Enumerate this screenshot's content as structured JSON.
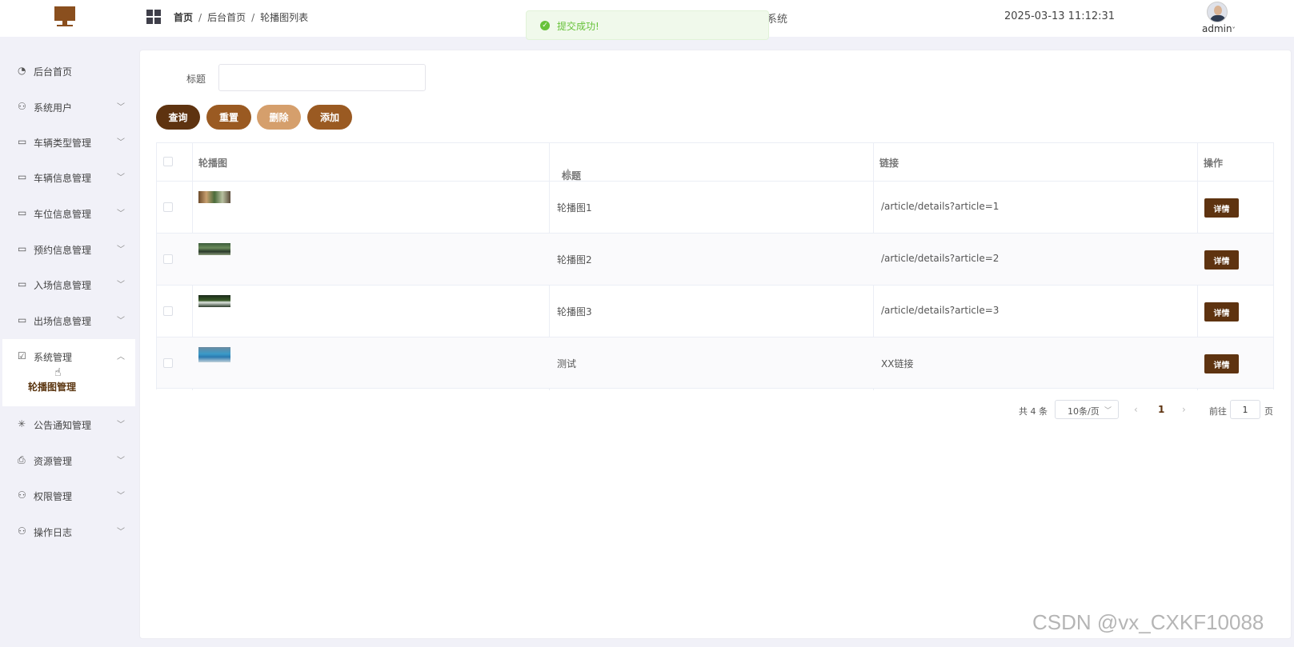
{
  "header": {
    "breadcrumb": [
      "首页",
      "后台首页",
      "轮播图列表"
    ],
    "system_name_partial": "系统",
    "datetime": "2025-03-13 11:12:31",
    "user": "admin"
  },
  "toast": {
    "message": "提交成功!",
    "type": "success"
  },
  "sidebar": {
    "items": [
      {
        "label": "后台首页",
        "icon": "pie-chart-icon"
      },
      {
        "label": "系统用户",
        "icon": "user-icon"
      },
      {
        "label": "车辆类型管理",
        "icon": "card-icon"
      },
      {
        "label": "车辆信息管理",
        "icon": "card-icon"
      },
      {
        "label": "车位信息管理",
        "icon": "card-icon"
      },
      {
        "label": "预约信息管理",
        "icon": "card-icon"
      },
      {
        "label": "入场信息管理",
        "icon": "card-icon"
      },
      {
        "label": "出场信息管理",
        "icon": "card-icon"
      },
      {
        "label": "系统管理",
        "icon": "folder-check-icon"
      },
      {
        "label": "公告通知管理",
        "icon": "loading-icon"
      },
      {
        "label": "资源管理",
        "icon": "print-icon"
      },
      {
        "label": "权限管理",
        "icon": "user-icon"
      },
      {
        "label": "操作日志",
        "icon": "user-icon"
      }
    ],
    "submenu_label": "轮播图管理"
  },
  "search": {
    "label": "标题",
    "value": ""
  },
  "toolbar": {
    "query": "查询",
    "reset": "重置",
    "delete": "删除",
    "add": "添加"
  },
  "table": {
    "columns": [
      "轮播图",
      "标题",
      "链接",
      "操作"
    ],
    "rows": [
      {
        "title": "轮播图1",
        "link": "/article/details?article=1",
        "action": "详情"
      },
      {
        "title": "轮播图2",
        "link": "/article/details?article=2",
        "action": "详情"
      },
      {
        "title": "轮播图3",
        "link": "/article/details?article=3",
        "action": "详情"
      },
      {
        "title": "测试",
        "link": "XX链接",
        "action": "详情"
      }
    ]
  },
  "pagination": {
    "total": "共 4 条",
    "page_size": "10条/页",
    "current": "1",
    "goto_prefix": "前往",
    "goto_value": "1",
    "goto_suffix": "页"
  },
  "watermark": "CSDN @vx_CXKF10088",
  "colors": {
    "primary": "#5e3310",
    "accent": "#9a5a22",
    "light_accent": "#d59f6c",
    "success": "#67c23a"
  }
}
